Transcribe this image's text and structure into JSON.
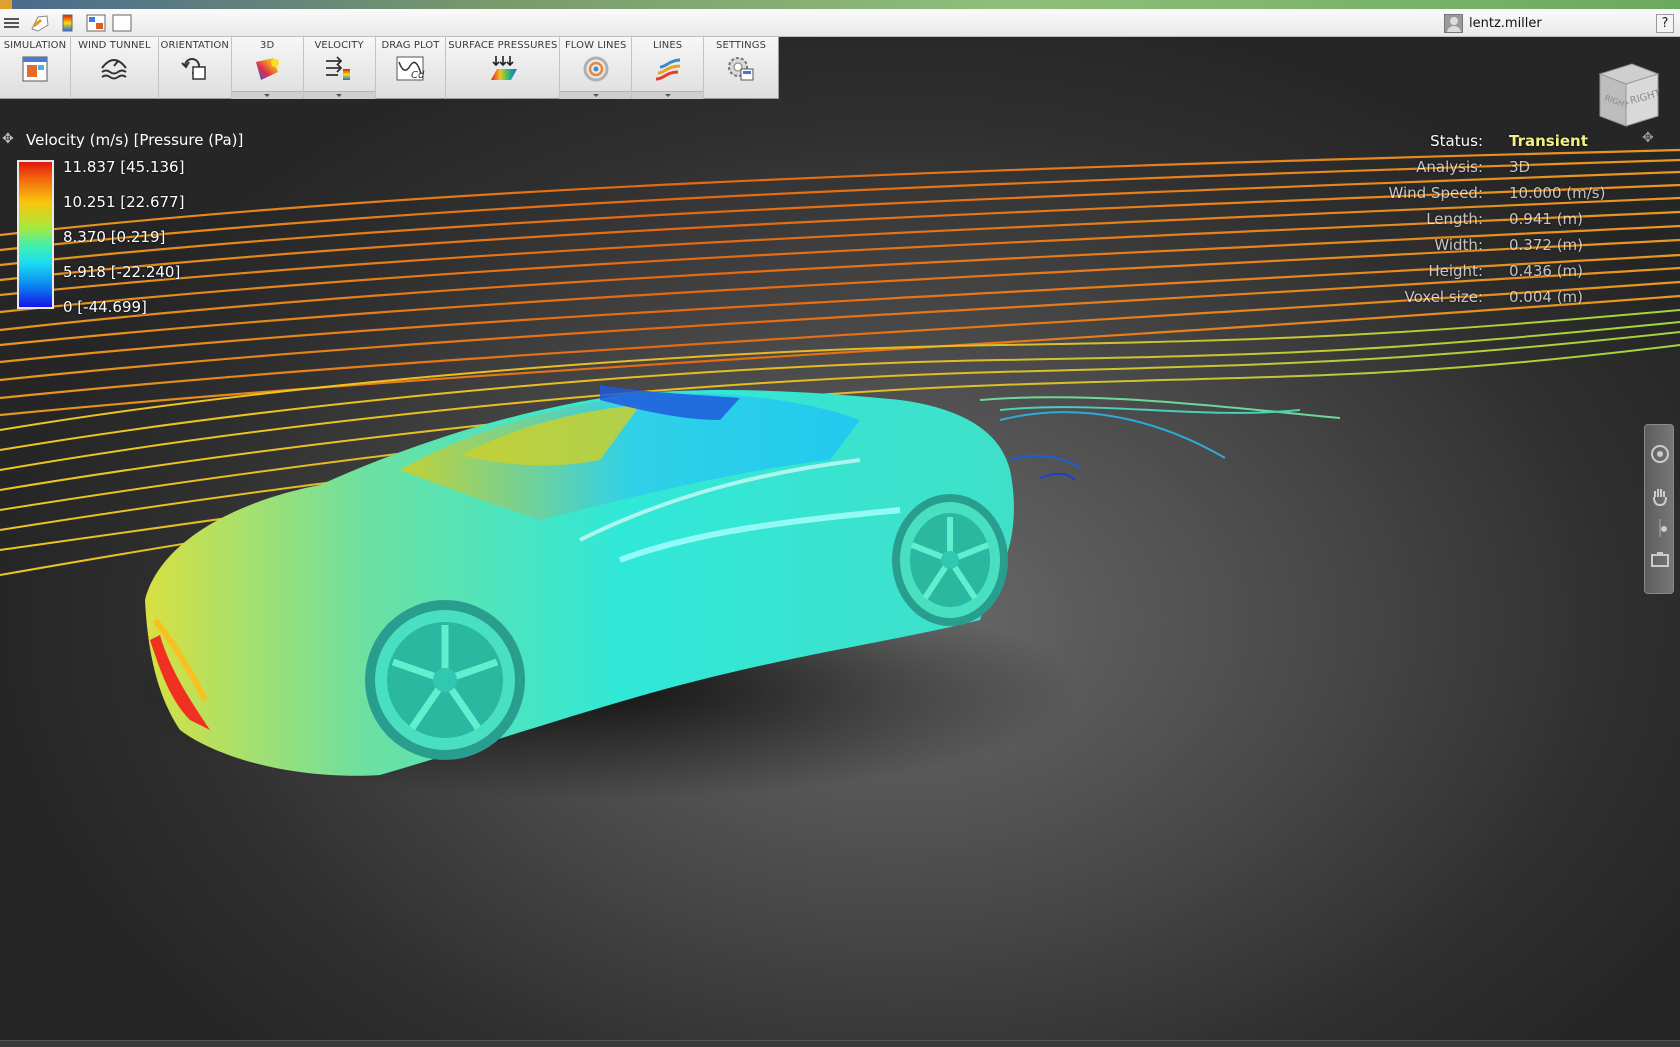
{
  "window": {
    "user_name": "lentz.miller",
    "help_label": "?"
  },
  "quick_access": [
    {
      "name": "menu-icon"
    },
    {
      "name": "save-icon"
    },
    {
      "name": "legend-toggle-icon"
    },
    {
      "name": "layout-icon"
    },
    {
      "name": "window-icon"
    }
  ],
  "ribbon": {
    "tabs": [
      {
        "label": "SIMULATION",
        "icon": "simulation-icon",
        "dropdown": false
      },
      {
        "label": "WIND TUNNEL",
        "icon": "wind-tunnel-icon",
        "dropdown": false
      },
      {
        "label": "ORIENTATION",
        "icon": "orientation-icon",
        "dropdown": false
      },
      {
        "label": "3D",
        "icon": "3d-icon",
        "dropdown": true
      },
      {
        "label": "VELOCITY",
        "icon": "velocity-icon",
        "dropdown": true
      },
      {
        "label": "DRAG PLOT",
        "icon": "drag-plot-icon",
        "dropdown": false
      },
      {
        "label": "SURFACE PRESSURES",
        "icon": "surface-pressures-icon",
        "dropdown": false
      },
      {
        "label": "FLOW LINES",
        "icon": "flow-lines-icon",
        "dropdown": true
      },
      {
        "label": "LINES",
        "icon": "lines-icon",
        "dropdown": true
      },
      {
        "label": "SETTINGS",
        "icon": "settings-icon",
        "dropdown": false
      }
    ]
  },
  "legend": {
    "title": "Velocity (m/s) [Pressure (Pa)]",
    "values": [
      "11.837 [45.136]",
      "10.251 [22.677]",
      "8.370 [0.219]",
      "5.918 [-22.240]",
      "0 [-44.699]"
    ],
    "colors": [
      "#e0170f",
      "#f8c60b",
      "#3ff0b0",
      "#0c86f0",
      "#1414e8"
    ]
  },
  "status_panel": {
    "rows": [
      {
        "label": "Status:",
        "value": "Transient"
      },
      {
        "label": "Analysis:",
        "value": "3D"
      },
      {
        "label": "Wind Speed:",
        "value": "10.000 (m/s)"
      },
      {
        "label": "Length:",
        "value": "0.941 (m)"
      },
      {
        "label": "Width:",
        "value": "0.372 (m)"
      },
      {
        "label": "Height:",
        "value": "0.436 (m)"
      },
      {
        "label": "Voxel size:",
        "value": "0.004 (m)"
      }
    ],
    "status_color": "#f3ef86"
  },
  "viewcube": {
    "face_label": "RIGHT",
    "side_label": "RIGHT"
  },
  "nav_bar": [
    {
      "name": "orbit-icon"
    },
    {
      "name": "pan-icon"
    },
    {
      "name": "zoom-slider-icon"
    },
    {
      "name": "camera-icon"
    }
  ]
}
